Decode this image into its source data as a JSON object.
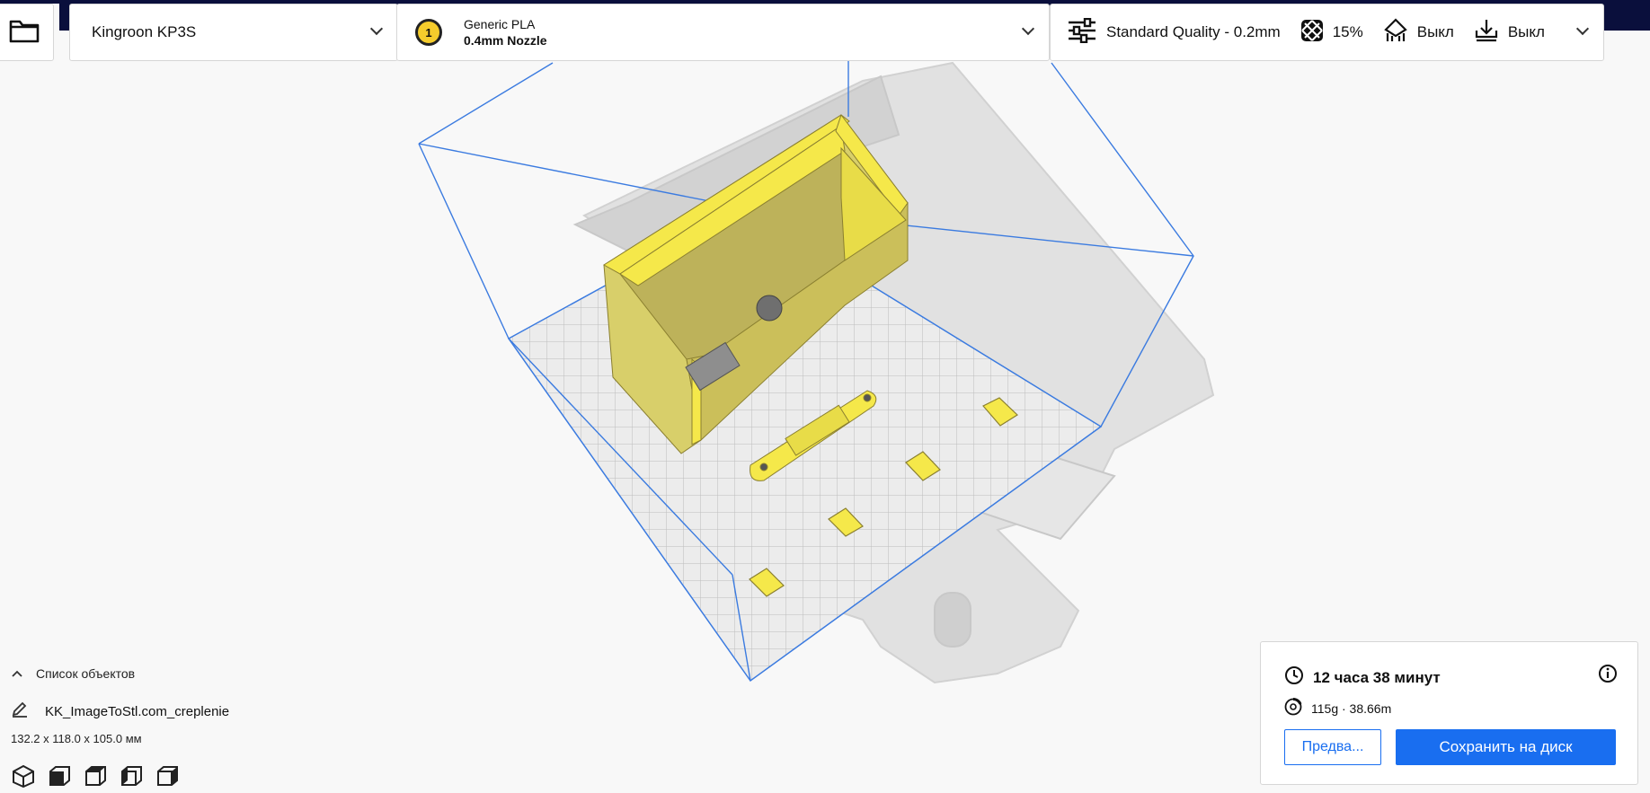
{
  "colors": {
    "accent": "#196ef0",
    "header_bg": "#0a0f3c",
    "model_yellow": "#f5e84a",
    "extruder_badge": "#f5cc2c"
  },
  "printer": {
    "name": "Kingroon KP3S"
  },
  "material": {
    "extruder_number": "1",
    "name": "Generic PLA",
    "nozzle": "0.4mm Nozzle"
  },
  "print_settings": {
    "profile": "Standard Quality - 0.2mm",
    "infill": "15%",
    "support": "Выкл",
    "adhesion": "Выкл"
  },
  "object_list": {
    "title": "Список объектов",
    "object_name": "KK_ImageToStl.com_creplenie",
    "dimensions": "132.2 x 118.0 x 105.0 мм"
  },
  "view_buttons": [
    "3d-view-icon",
    "front-view-icon",
    "top-view-icon",
    "left-view-icon",
    "right-view-icon"
  ],
  "print_info": {
    "time": "12 часа 38 минут",
    "material_usage": "115g · 38.66m",
    "preview_label": "Предва...",
    "save_label": "Сохранить на диск"
  }
}
